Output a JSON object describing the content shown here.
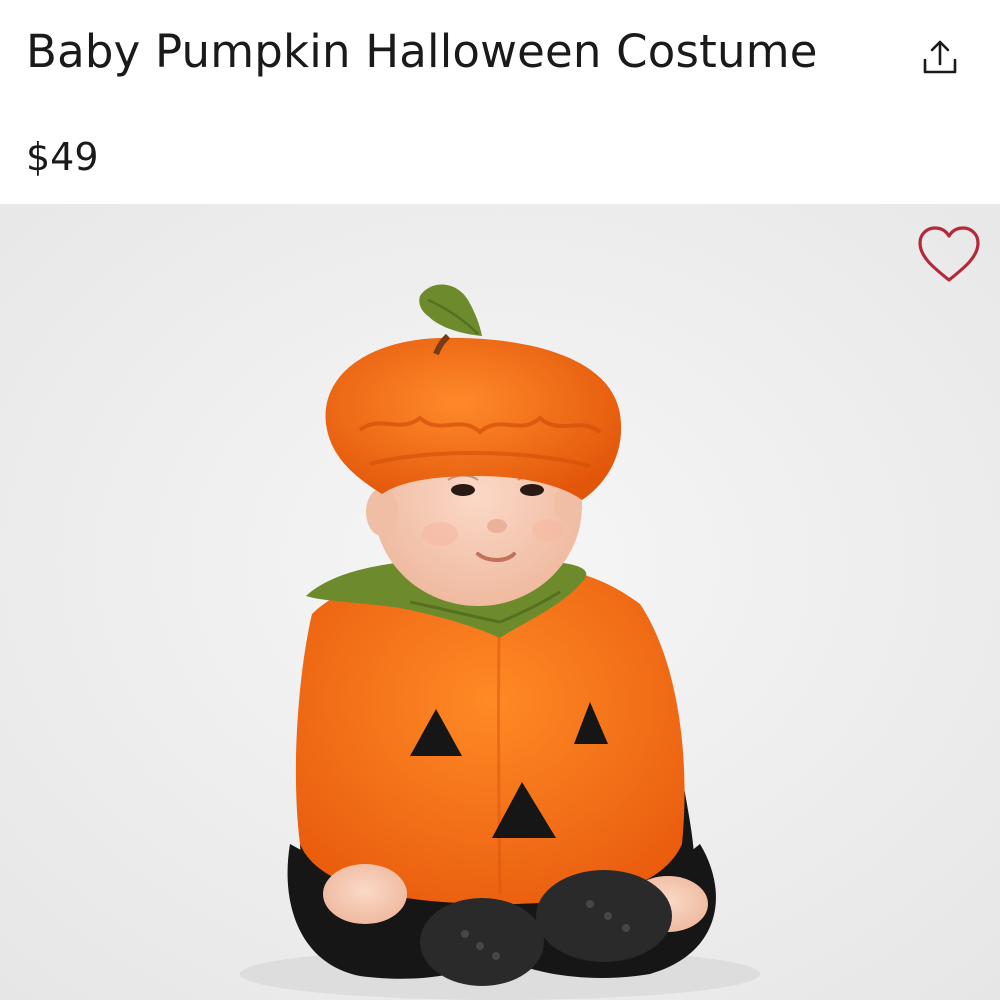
{
  "product": {
    "title": "Baby Pumpkin Halloween Costume",
    "price": "$49"
  },
  "actions": {
    "share_icon": "share-icon",
    "favorite_icon": "heart-outline-icon"
  },
  "colors": {
    "text": "#1a1a1a",
    "favorite_accent": "#b5283a",
    "photo_background": "#efefef"
  }
}
